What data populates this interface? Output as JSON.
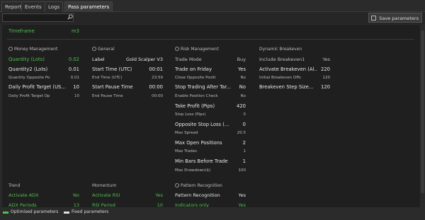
{
  "tabs": [
    "Report",
    "Events",
    "Logs",
    "Pass parameters"
  ],
  "toolbar": {
    "search_value": "",
    "save_label": "Save parameters"
  },
  "top": {
    "label": "Timeframe",
    "value": "m3"
  },
  "sections": {
    "money": {
      "title": "Money Management",
      "rows": [
        {
          "label": "Quantity (Lots)",
          "value": "0.02",
          "style": "green big"
        },
        {
          "label": "Quantity2 (Lots)",
          "value": "0.01",
          "style": "white big"
        },
        {
          "label": "Quantity Opposite Po",
          "value": "0.01",
          "style": "dim small"
        },
        {
          "label": "Daily Profit Target (US...",
          "value": "10",
          "style": "white big"
        },
        {
          "label": "Daily Profit Target Op",
          "value": "10",
          "style": "dim small"
        }
      ]
    },
    "general": {
      "title": "General",
      "rows": [
        {
          "label": "Label",
          "value": "Gold Scalper V3",
          "style": "white"
        },
        {
          "label": "Start Time (UTC)",
          "value": "00:01",
          "style": "white big"
        },
        {
          "label": "End Time (UTC)",
          "value": "23:59",
          "style": "dim small"
        },
        {
          "label": "Start Pause Time",
          "value": "00:00",
          "style": "white big"
        },
        {
          "label": "End Pause Time",
          "value": "00:00",
          "style": "dim small"
        }
      ]
    },
    "risk": {
      "title": "Risk Management",
      "rows": [
        {
          "label": "Trade Mode",
          "value": "Buy",
          "style": "dim"
        },
        {
          "label": "Trade on Friday",
          "value": "Yes",
          "style": "white big"
        },
        {
          "label": "Close Opposite Positi",
          "value": "No",
          "style": "dim small"
        },
        {
          "label": "Stop Trading After Tar...",
          "value": "No",
          "style": "white big"
        },
        {
          "label": "Enable Position Check",
          "value": "No",
          "style": "dim small"
        },
        {
          "label": "Take Profit (Pips)",
          "value": "420",
          "style": "white big"
        },
        {
          "label": "Stop Loss (Pips)",
          "value": "0",
          "style": "dim small"
        },
        {
          "label": "Opposite Stop Loss (...",
          "value": "0",
          "style": "white big"
        },
        {
          "label": "Max Spread",
          "value": "20.5",
          "style": "dim small"
        },
        {
          "label": "Max Open Positions",
          "value": "2",
          "style": "white big"
        },
        {
          "label": "Max Trades",
          "value": "1",
          "style": "dim small"
        },
        {
          "label": "Min Bars Before Trade",
          "value": "1",
          "style": "white big"
        },
        {
          "label": "Max Drawdown($)",
          "value": "100",
          "style": "dim small"
        }
      ]
    },
    "breakeven": {
      "title": "Dynamic Breakeven",
      "rows": [
        {
          "label": "Include Breakeven1",
          "value": "Yes",
          "style": "dim"
        },
        {
          "label": "Activate Breakeven (Al...",
          "value": "220",
          "style": "white big"
        },
        {
          "label": "Initial Breakeven Offs",
          "value": "120",
          "style": "dim small"
        },
        {
          "label": "Breakeven Step Size...",
          "value": "120",
          "style": "white big"
        }
      ]
    },
    "trend": {
      "title": "Trend",
      "rows": [
        {
          "label": "Activate ADX",
          "value": "No",
          "style": "green"
        },
        {
          "label": "ADX Periods",
          "value": "13",
          "style": "green"
        }
      ]
    },
    "momentum": {
      "title": "Momentum",
      "rows": [
        {
          "label": "Activate RSI",
          "value": "Yes",
          "style": "green"
        },
        {
          "label": "RSI Period",
          "value": "10",
          "style": "green"
        }
      ]
    },
    "pattern": {
      "title": "Pattern Recognition",
      "rows": [
        {
          "label": "Pattern Recognition",
          "value": "Yes",
          "style": "white"
        },
        {
          "label": "Indicators only",
          "value": "Yes",
          "style": "green"
        }
      ]
    }
  },
  "legend": {
    "optimised": "Optimised parameters",
    "fixed": "Fixed parameters"
  },
  "colors": {
    "green": "#4fbf4f",
    "background": "#1f1f1f"
  }
}
